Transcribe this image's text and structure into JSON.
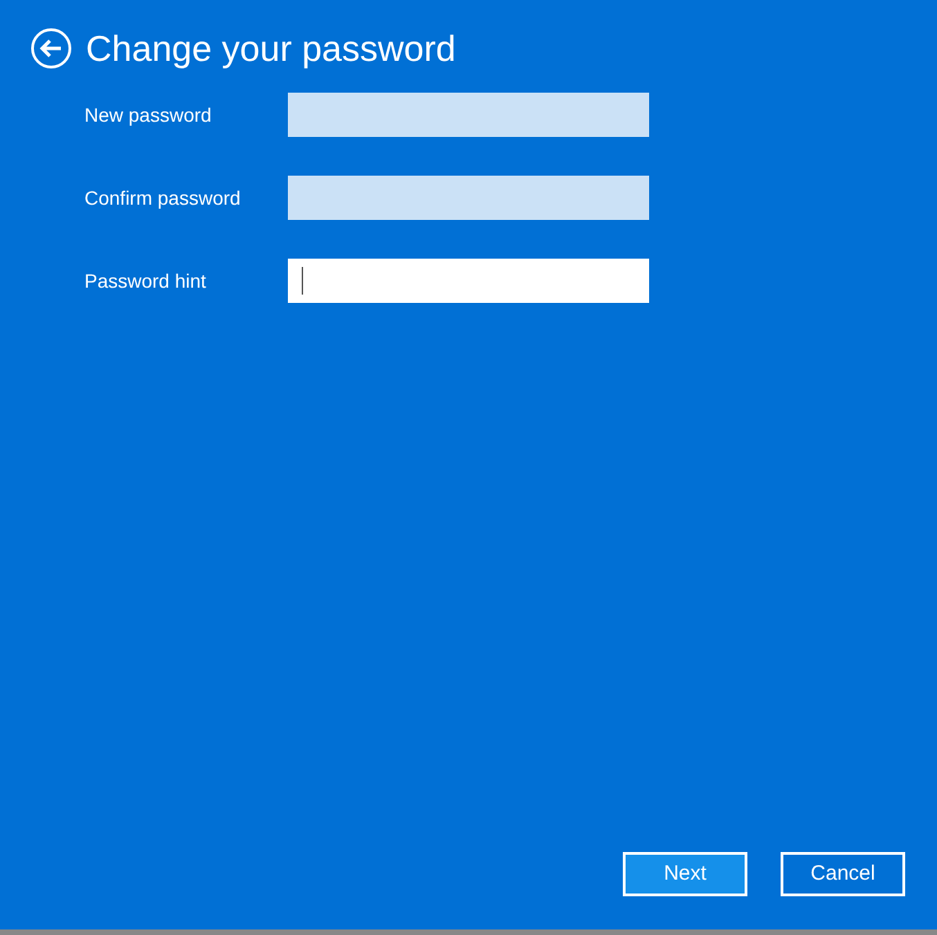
{
  "title": "Change your password",
  "fields": [
    {
      "label": "New password",
      "focused": false
    },
    {
      "label": "Confirm password",
      "focused": false
    },
    {
      "label": "Password hint",
      "focused": true
    }
  ],
  "buttons": [
    {
      "label": "Next",
      "default": true
    },
    {
      "label": "Cancel",
      "default": false
    }
  ]
}
